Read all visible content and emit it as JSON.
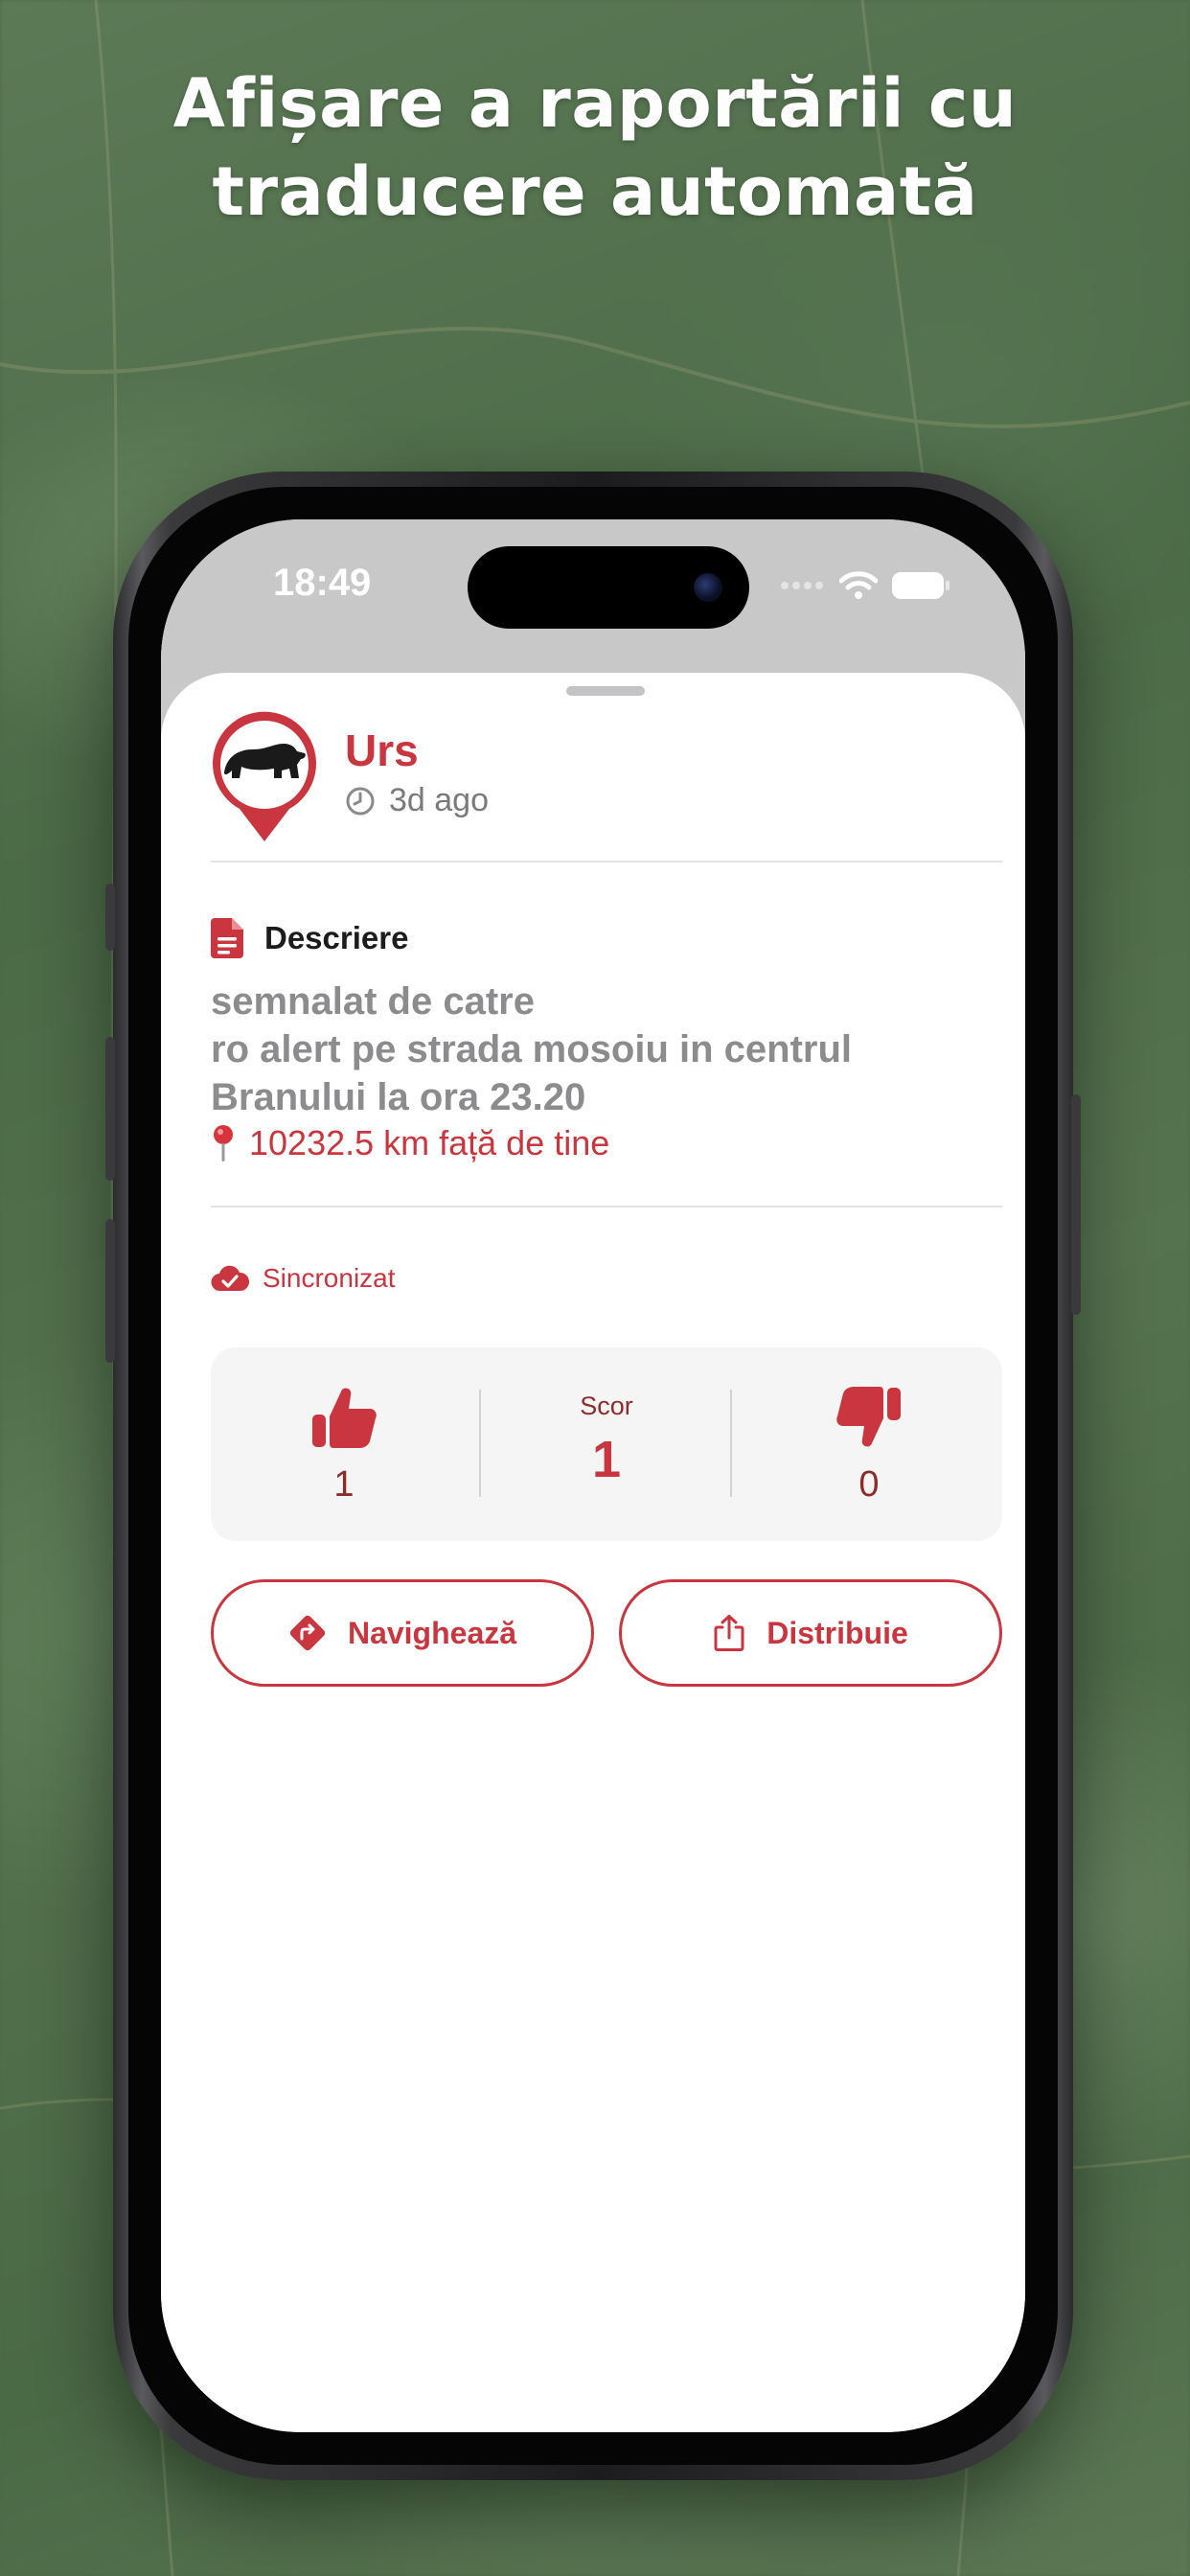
{
  "headline": {
    "line1": "Afișare a raportării cu",
    "line2": "traducere automată"
  },
  "status_bar": {
    "time": "18:49"
  },
  "report": {
    "title": "Urs",
    "time_ago": "3d ago",
    "description_label": "Descriere",
    "description": "semnalat de catre\nro alert pe strada mosoiu in centrul\nBranului la ora 23.20",
    "distance": "10232.5 km față de tine",
    "sync_status": "Sincronizat"
  },
  "votes": {
    "upvotes": "1",
    "score_label": "Scor",
    "score": "1",
    "downvotes": "0"
  },
  "actions": {
    "navigate_label": "Navighează",
    "share_label": "Distribuie"
  },
  "colors": {
    "accent": "#c9363f",
    "vote_text": "#8e2c2c"
  },
  "icons": {
    "pin": "bear-pin-icon",
    "time": "clock-icon",
    "description": "document-icon",
    "distance": "map-pin-icon",
    "sync": "cloud-check-icon",
    "upvote": "thumbs-up-icon",
    "downvote": "thumbs-down-icon",
    "navigate": "directions-icon",
    "share": "share-icon"
  }
}
